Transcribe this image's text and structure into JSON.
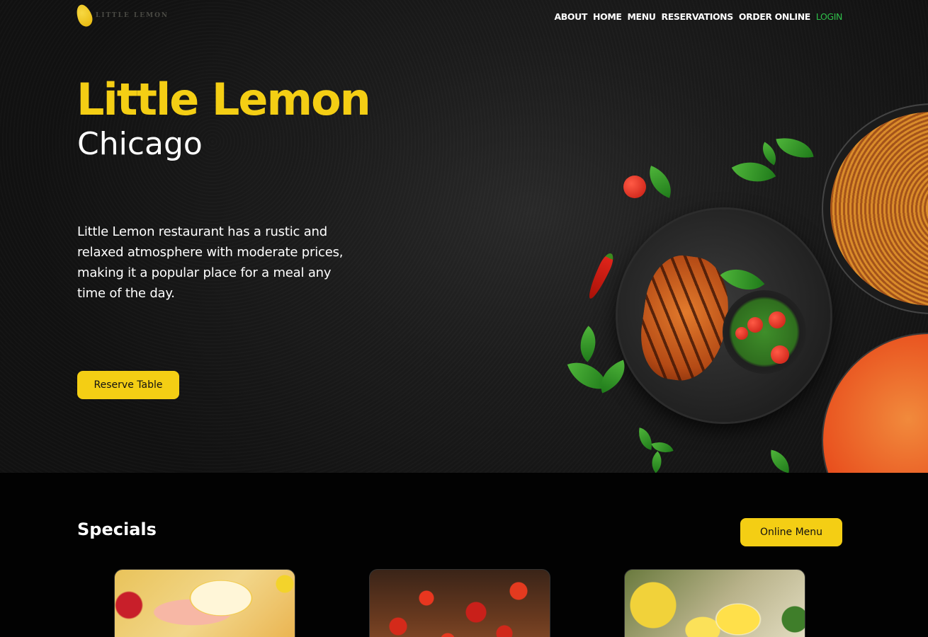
{
  "brand": {
    "logo_text": "LITTLE LEMON"
  },
  "nav": {
    "items": [
      {
        "label": "ABOUT"
      },
      {
        "label": "HOME"
      },
      {
        "label": "MENU"
      },
      {
        "label": "RESERVATIONS"
      },
      {
        "label": "ORDER ONLINE"
      },
      {
        "label": "LOGIN"
      }
    ]
  },
  "hero": {
    "title": "Little Lemon",
    "subtitle": "Chicago",
    "description": "Little Lemon restaurant has a rustic and relaxed atmosphere with moderate prices, making it a popular place for a meal any time of the day.",
    "cta_label": "Reserve Table"
  },
  "specials": {
    "title": "Specials",
    "menu_button_label": "Online Menu"
  },
  "colors": {
    "accent": "#f4ce14",
    "login": "#2fbf4a",
    "background": "#020202"
  }
}
